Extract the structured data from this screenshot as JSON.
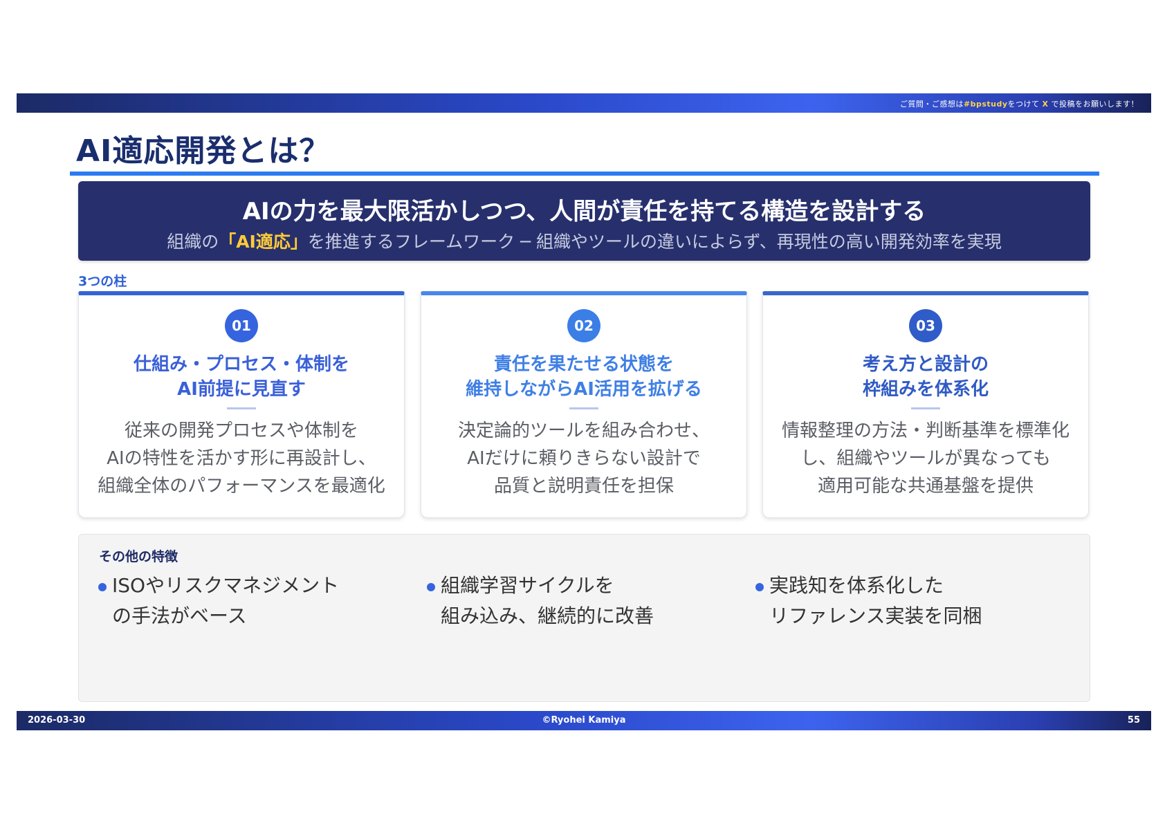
{
  "header": {
    "note_prefix": "ご質問・ご感想は",
    "hashtag": "#bpstudy",
    "note_mid": "をつけて",
    "platform": "X",
    "note_suffix": "で投稿をお願いします！"
  },
  "title": "AI適応開発とは？",
  "hero": {
    "main": "AIの力を最大限活かしつつ、人間が責任を持てる構造を設計する",
    "sub_prefix": "組織の",
    "sub_emphasis": "「AI適応」",
    "sub_suffix": "を推進するフレームワーク ─ 組織やツールの違いによらず、再現性の高い開発効率を実現"
  },
  "pillars_label": "3つの柱",
  "pillars": [
    {
      "number": "01",
      "title": [
        "仕組み・プロセス・体制を",
        "AI前提に見直す"
      ],
      "desc": [
        "従来の開発プロセスや体制を",
        "AIの特性を活かす形に再設計し、",
        "組織全体のパフォーマンスを最適化"
      ]
    },
    {
      "number": "02",
      "title": [
        "責任を果たせる状態を",
        "維持しながらAI活用を拡げる"
      ],
      "desc": [
        "決定論的ツールを組み合わせ、",
        "AIだけに頼りきらない設計で",
        "品質と説明責任を担保"
      ]
    },
    {
      "number": "03",
      "title": [
        "考え方と設計の",
        "枠組みを体系化"
      ],
      "desc": [
        "情報整理の方法・判断基準を標準化",
        "し、組織やツールが異なっても",
        "適用可能な共通基盤を提供"
      ]
    }
  ],
  "others": {
    "label": "その他の特徴",
    "items": [
      [
        "ISOやリスクマネジメント",
        "の手法がベース"
      ],
      [
        "組織学習サイクルを",
        "組み込み、継続的に改善"
      ],
      [
        "実践知を体系化した",
        "リファレンス実装を同梱"
      ]
    ]
  },
  "footer": {
    "date": "2026-03-30",
    "copyright": "©Ryohei Kamiya",
    "page_number": "55"
  }
}
